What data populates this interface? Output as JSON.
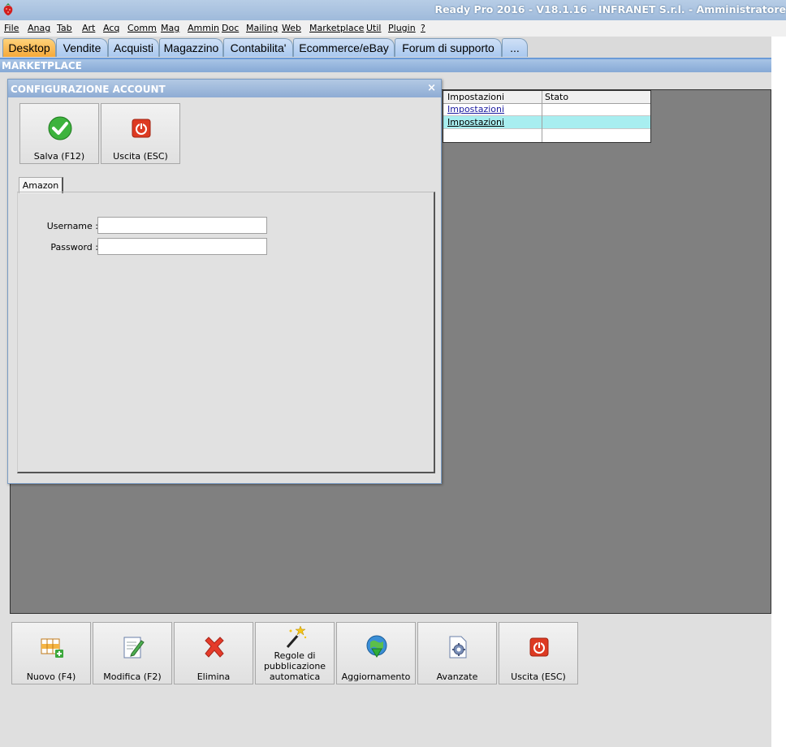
{
  "window": {
    "title": "Ready Pro 2016 - V18.1.16 - INFRANET S.r.l. - Amministratore"
  },
  "menu": [
    "File",
    "Anag",
    "Tab",
    "Art",
    "Acq",
    "Comm",
    "Mag",
    "Ammin",
    "Doc",
    "Mailing",
    "Web",
    "Marketplace",
    "Util",
    "Plugin",
    "?"
  ],
  "tabs": [
    "Desktop",
    "Vendite",
    "Acquisti",
    "Magazzino",
    "Contabilita'",
    "Ecommerce/eBay",
    "Forum di supporto",
    "..."
  ],
  "active_tab": "Desktop",
  "section_title": "MARKETPLACE",
  "grid": {
    "columns": [
      "Impostazioni",
      "Stato"
    ],
    "rows": [
      {
        "impostazioni": "Impostazioni",
        "stato": "",
        "selected": false
      },
      {
        "impostazioni": "Impostazioni",
        "stato": "",
        "selected": true
      }
    ]
  },
  "bottom_buttons": [
    {
      "label": "Nuovo (F4)",
      "icon": "new-grid-icon"
    },
    {
      "label": "Modifica (F2)",
      "icon": "edit-icon"
    },
    {
      "label": "Elimina",
      "icon": "delete-icon"
    },
    {
      "label": "Regole di pubblicazione automatica",
      "icon": "magic-wand-icon"
    },
    {
      "label": "Aggiornamento",
      "icon": "update-globe-icon"
    },
    {
      "label": "Avanzate",
      "icon": "settings-document-icon"
    },
    {
      "label": "Uscita (ESC)",
      "icon": "power-icon"
    }
  ],
  "dialog": {
    "title": "CONFIGURAZIONE ACCOUNT",
    "close": "×",
    "save_label": "Salva (F12)",
    "exit_label": "Uscita (ESC)",
    "tab": "Amazon",
    "username_label": "Username :",
    "username_value": "",
    "password_label": "Password :",
    "password_value": ""
  },
  "colors": {
    "active_tab": "#f5a93a",
    "selected_row": "#a8eef0",
    "panel_gray": "#808080"
  }
}
